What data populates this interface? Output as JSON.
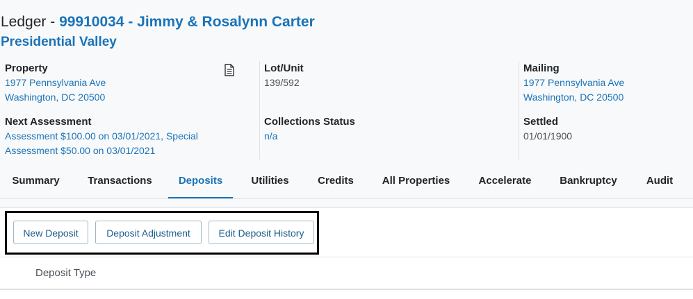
{
  "header": {
    "prefix": "Ledger - ",
    "account": "99910034 - Jimmy & Rosalynn Carter",
    "community": "Presidential Valley"
  },
  "info": {
    "property": {
      "label": "Property",
      "line1": "1977 Pennsylvania Ave",
      "line2": "Washington, DC 20500"
    },
    "lot_unit": {
      "label": "Lot/Unit",
      "value": "139/592"
    },
    "mailing": {
      "label": "Mailing",
      "line1": "1977 Pennsylvania Ave",
      "line2": "Washington, DC 20500"
    },
    "next_assessment": {
      "label": "Next Assessment",
      "line1": "Assessment $100.00 on 03/01/2021, Special",
      "line2": "Assessment $50.00 on 03/01/2021"
    },
    "collections_status": {
      "label": "Collections Status",
      "value": "n/a"
    },
    "settled": {
      "label": "Settled",
      "value": "01/01/1900"
    }
  },
  "tabs": [
    {
      "label": "Summary"
    },
    {
      "label": "Transactions"
    },
    {
      "label": "Deposits",
      "active": true
    },
    {
      "label": "Utilities"
    },
    {
      "label": "Credits"
    },
    {
      "label": "All Properties"
    },
    {
      "label": "Accelerate"
    },
    {
      "label": "Bankruptcy"
    },
    {
      "label": "Audit"
    }
  ],
  "actions": {
    "new_deposit": "New Deposit",
    "deposit_adjustment": "Deposit Adjustment",
    "edit_deposit_history": "Edit Deposit History"
  },
  "table": {
    "columns": [
      "Deposit Type"
    ]
  },
  "colors": {
    "accent": "#1a73b8",
    "text": "#212529",
    "border": "#dee2e6",
    "highlight": "#000000"
  },
  "icons": {
    "property_doc": "document-icon"
  }
}
